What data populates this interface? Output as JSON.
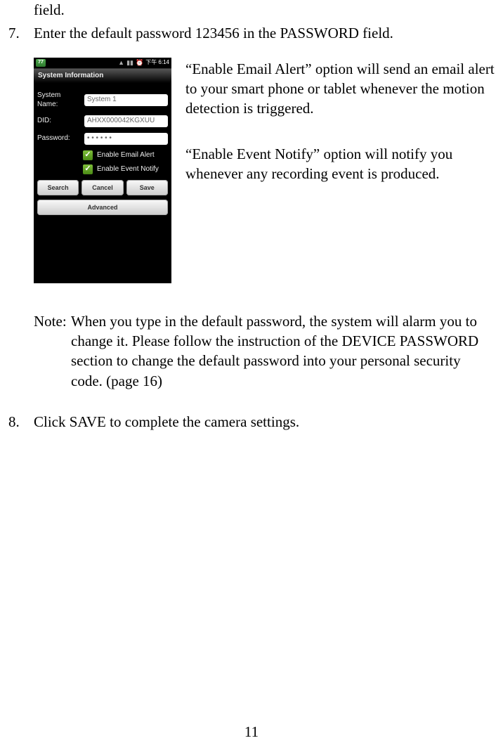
{
  "prev_field_fragment": "field.",
  "step7": {
    "num": "7.",
    "text": "Enter the default password 123456 in the PASSWORD field."
  },
  "phone": {
    "statusbar": {
      "badge": "77",
      "time": "下午 6:14"
    },
    "header": "System Information",
    "fields": {
      "system_name_label": "System Name:",
      "system_name_value": "System 1",
      "did_label": "DID:",
      "did_value": "AHXX000042KGXUU",
      "password_label": "Password:",
      "password_value": "• • • • • •"
    },
    "checks": {
      "email_alert": "Enable Email Alert",
      "event_notify": "Enable Event Notify"
    },
    "buttons": {
      "search": "Search",
      "cancel": "Cancel",
      "save": "Save",
      "advanced": "Advanced"
    }
  },
  "aside": {
    "p1": "“Enable Email Alert” option will send an email alert to your smart phone or tablet whenever the motion detection is triggered.",
    "p2": "“Enable Event Notify” option will notify you whenever any recording event is produced."
  },
  "note": {
    "label": "Note:",
    "text": "When you type in the default password, the system will alarm you to change it. Please follow the instruction of the DEVICE PASSWORD section to change the default password into your personal security code. (page 16)"
  },
  "step8": {
    "num": "8.",
    "text": "Click SAVE to complete the camera settings."
  },
  "page_number": "11"
}
